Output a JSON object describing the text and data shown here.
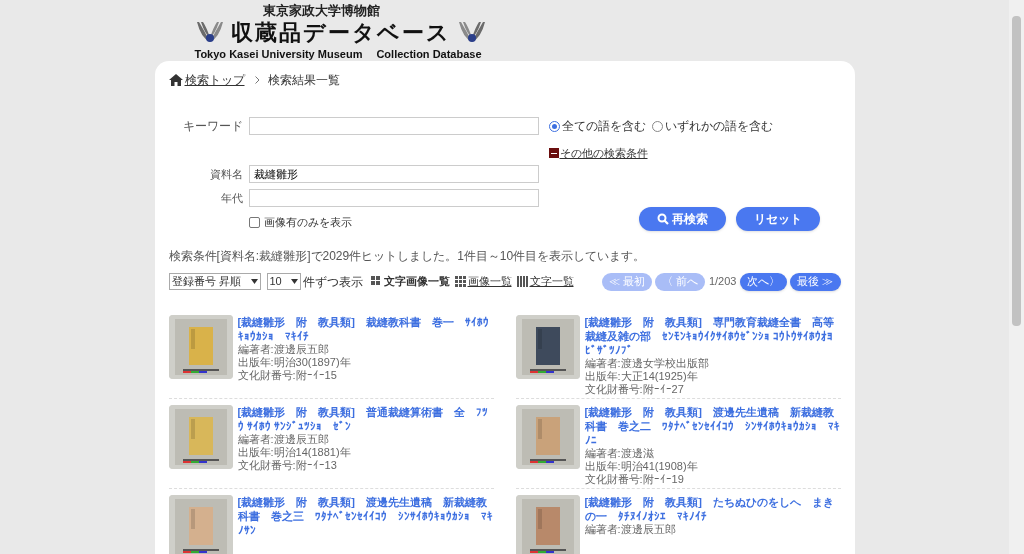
{
  "header": {
    "museum": "東京家政大学博物館",
    "title": "収蔵品データベース",
    "subtitle_left": "Tokyo Kasei University Museum",
    "subtitle_right": "Collection Database"
  },
  "breadcrumb": [
    {
      "label": "検索トップ",
      "link": true
    },
    {
      "label": "検索結果一覧",
      "link": false
    }
  ],
  "search": {
    "keyword": {
      "label": "キーワード"
    },
    "match_options": [
      {
        "label": "全ての語を含む",
        "selected": true
      },
      {
        "label": "いずれかの語を含む",
        "selected": false
      }
    ],
    "other_conditions": {
      "label": "その他の検索条件",
      "expanded": true
    },
    "fields": [
      {
        "label": "資料名",
        "value": "裁縫雛形"
      },
      {
        "label": "年代"
      }
    ],
    "image_only": {
      "label": "画像有のみを表示",
      "checked": false
    },
    "buttons": [
      {
        "label": "再検索",
        "kind": "search"
      },
      {
        "label": "リセット",
        "kind": "reset"
      }
    ]
  },
  "summary": "検索条件[資料名:裁縫雛形]で2029件ヒットしました。1件目～10件目を表示しています。",
  "sort": {
    "value": "登録番号 昇順"
  },
  "per_page": {
    "value": "10",
    "suffix": "件ずつ表示"
  },
  "views": [
    {
      "label": "文字画像一覧",
      "selected": true,
      "kind": "mixed"
    },
    {
      "label": "画像一覧",
      "selected": false,
      "kind": "grid"
    },
    {
      "label": "文字一覧",
      "selected": false,
      "kind": "list"
    }
  ],
  "pager": {
    "buttons": [
      {
        "label": "≪ 最初",
        "disabled": true
      },
      {
        "label": "〈 前へ",
        "disabled": true
      },
      {
        "label": "次へ〉",
        "disabled": false
      },
      {
        "label": "最後 ≫",
        "disabled": false
      }
    ],
    "position": "1/203"
  },
  "results": [
    {
      "title": "[裁縫雛形　附　教具類]　裁縫教科書　巻一　ｻｲﾎｳｷｮｳｶｼｮ　ﾏｷｲﾁ",
      "meta": [
        "編著者:渡邊辰五郎",
        "出版年:明治30(1897)年",
        "文化財番号:附ｰｲｰ15"
      ]
    },
    {
      "title": "[裁縫雛形　附　教具類]　専門教育裁縫全書　高等裁縫及雑の部　ｾﾝﾓﾝｷｮｳｲｸｻｲﾎｳｾﾞﾝｼｮ ｺｳﾄｳｻｲﾎｳｵﾖﾋﾞｻﾞﾂﾉﾌﾞ",
      "meta": [
        "編著者:渡邊女学校出版部",
        "出版年:大正14(1925)年",
        "文化財番号:附ｰｲｰ27"
      ]
    },
    {
      "title": "[裁縫雛形　附　教具類]　普通裁縫算術書　全　ﾌﾂｳ ｻｲﾎｳ ｻﾝｼﾞｭﾂｼｮ　ｾﾞﾝ",
      "meta": [
        "編著者:渡邊辰五郎",
        "出版年:明治14(1881)年",
        "文化財番号:附ｰｲｰ13"
      ]
    },
    {
      "title": "[裁縫雛形　附　教具類]　渡邊先生遺稿　新裁縫教科書　巻之二　ﾜﾀﾅﾍﾞｾﾝｾｲｲｺｳ　ｼﾝｻｲﾎｳｷｮｳｶｼｮ　ﾏｷﾉﾆ",
      "meta": [
        "編著者:渡邊滋",
        "出版年:明治41(1908)年",
        "文化財番号:附ｰｲｰ19"
      ]
    },
    {
      "title": "[裁縫雛形　附　教具類]　渡邊先生遺稿　新裁縫教科書　巻之三　ﾜﾀﾅﾍﾞｾﾝｾｲｲｺｳ　ｼﾝｻｲﾎｳｷｮｳｶｼｮ　ﾏｷﾉｻﾝ"
    },
    {
      "title": "[裁縫雛形　附　教具類]　たちぬひのをしへ　まきの一　ﾀﾁﾇｲﾉｵｼｴ　ﾏｷﾉｲﾁ",
      "meta": [
        "編著者:渡邊辰五郎"
      ]
    }
  ]
}
